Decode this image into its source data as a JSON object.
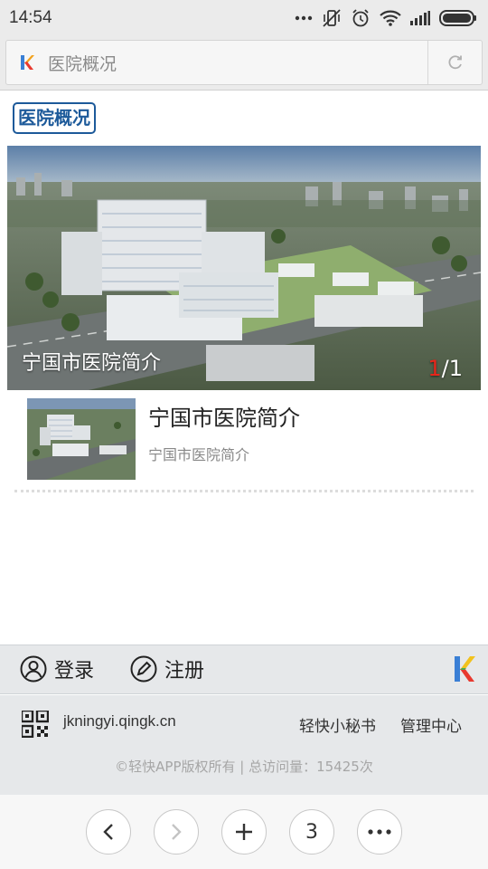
{
  "status_bar": {
    "time": "14:54",
    "icons": [
      "more-dots-icon",
      "vibrate-off-icon",
      "alarm-icon",
      "wifi-icon",
      "signal-icon",
      "battery-icon"
    ]
  },
  "address_bar": {
    "logo_icon": "qingkuai-k-logo",
    "page_title": "医院概况",
    "reload_icon": "reload-icon"
  },
  "page": {
    "section_tag": "医院概况",
    "banner": {
      "caption": "宁国市医院简介",
      "counter_current": "1",
      "counter_total": "/1"
    },
    "articles": [
      {
        "title": "宁国市医院简介",
        "subtitle": "宁国市医院简介"
      }
    ]
  },
  "account_bar": {
    "login_label": "登录",
    "register_label": "注册"
  },
  "footer": {
    "site_url": "jkningyi.qingk.cn",
    "secretary_link": "轻快小秘书",
    "admin_link": "管理中心",
    "copyright": "©轻快APP版权所有 | 总访问量：15425次"
  },
  "nav_bar": {
    "tab_count": "3"
  },
  "colors": {
    "accent_blue": "#1d5a9a",
    "counter_red": "#e8261b"
  }
}
